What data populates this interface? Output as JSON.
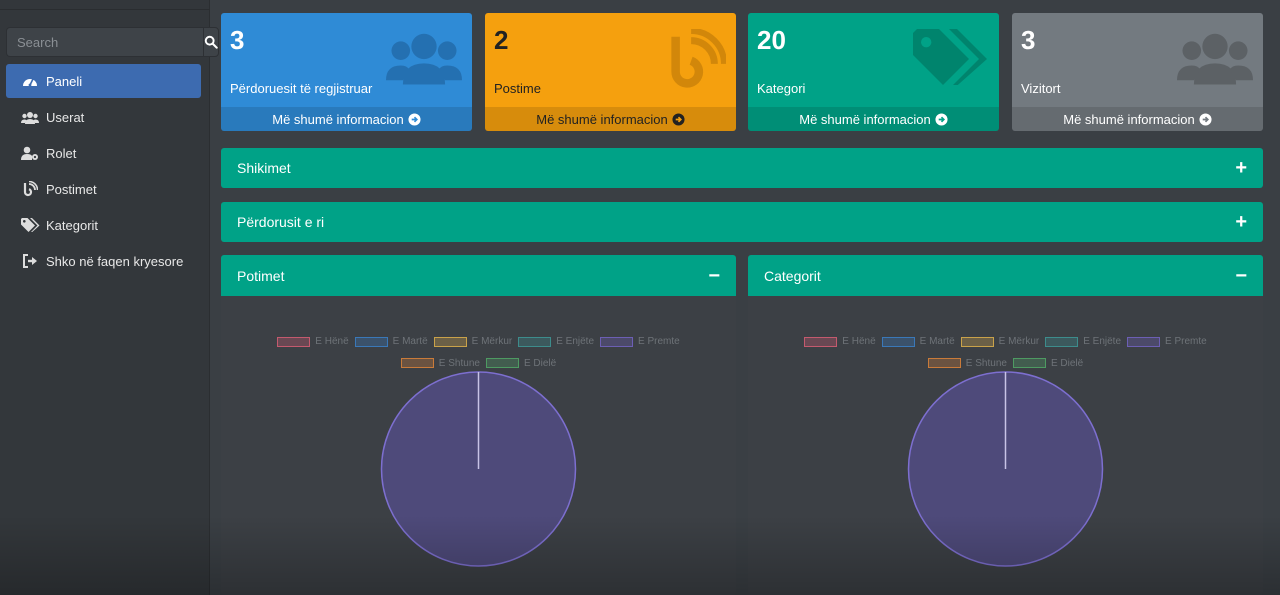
{
  "sidebar": {
    "search": {
      "placeholder": "Search"
    },
    "items": [
      {
        "label": "Paneli",
        "icon": "dashboard-icon",
        "active": true
      },
      {
        "label": "Userat",
        "icon": "users-icon"
      },
      {
        "label": "Rolet",
        "icon": "user-cog-icon"
      },
      {
        "label": "Postimet",
        "icon": "blog-icon"
      },
      {
        "label": "Kategorit",
        "icon": "tags-icon"
      },
      {
        "label": "Shko në faqen kryesore",
        "icon": "sign-out-icon"
      }
    ]
  },
  "boxes": [
    {
      "count": "3",
      "label": "Përdoruesit të regjistruar",
      "link": "Më shumë informacion",
      "color": "#2f8bd6",
      "icon": "users-icon"
    },
    {
      "count": "2",
      "label": "Postime",
      "link": "Më shumë informacion",
      "color": "#f5a00e",
      "icon": "blog-icon"
    },
    {
      "count": "20",
      "label": "Kategori",
      "link": "Më shumë informacion",
      "color": "#00a287",
      "icon": "tags-icon"
    },
    {
      "count": "3",
      "label": "Vizitort",
      "link": "Më shumë informacion",
      "color": "#737a80",
      "icon": "users-icon"
    }
  ],
  "panels": {
    "views": {
      "title": "Shikimet",
      "toggle": "+"
    },
    "new_users": {
      "title": "Përdorusit e ri",
      "toggle": "+"
    },
    "posts": {
      "title": "Potimet",
      "toggle": "−"
    },
    "categories": {
      "title": "Categorit",
      "toggle": "−"
    }
  },
  "chart_data": [
    {
      "type": "pie",
      "title": "Potimet",
      "categories": [
        "E Hënë",
        "E Martë",
        "E Mërkur",
        "E Enjëte",
        "E Premte",
        "E Shtune",
        "E Dielë"
      ],
      "values": [
        0,
        0,
        0,
        0,
        1,
        0,
        0
      ],
      "colors": [
        "#c45a6e",
        "#3a78b8",
        "#c9a24a",
        "#3d8c8c",
        "#6c5fb4",
        "#c97b3a",
        "#4e9a62"
      ],
      "legend": "top"
    },
    {
      "type": "pie",
      "title": "Categorit",
      "categories": [
        "E Hënë",
        "E Martë",
        "E Mërkur",
        "E Enjëte",
        "E Premte",
        "E Shtune",
        "E Dielë"
      ],
      "values": [
        0,
        0,
        0,
        0,
        1,
        0,
        0
      ],
      "colors": [
        "#c45a6e",
        "#3a78b8",
        "#c9a24a",
        "#3d8c8c",
        "#6c5fb4",
        "#c97b3a",
        "#4e9a62"
      ],
      "legend": "top"
    }
  ]
}
